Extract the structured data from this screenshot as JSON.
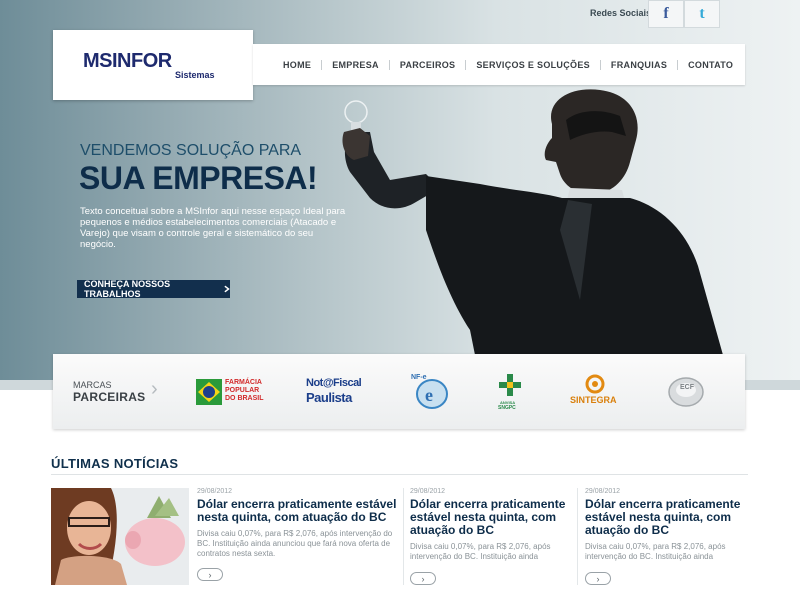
{
  "social": {
    "label": "Redes Sociais",
    "facebook": "f",
    "twitter": "t"
  },
  "logo": {
    "main": "MSINFOR",
    "sub": "Sistemas"
  },
  "nav": [
    "HOME",
    "EMPRESA",
    "PARCEIROS",
    "SERVIÇOS E SOLUÇÕES",
    "FRANQUIAS",
    "CONTATO"
  ],
  "hero": {
    "pre": "VENDEMOS SOLUÇÃO PARA",
    "title": "SUA EMPRESA!",
    "desc": "Texto conceitual sobre a MSInfor aqui nesse espaço Ideal para pequenos e médios estabelecimentos comerciais (Atacado e Varejo) que visam o controle geral e sistemático do seu negócio.",
    "cta": "CONHEÇA NOSSOS TRABALHOS"
  },
  "partners": {
    "label_small": "MARCAS",
    "label_big": "PARCEIRAS",
    "farmacia": [
      "FARMÁCIA",
      "POPULAR",
      "DO BRASIL"
    ],
    "nota_top": "Not@Fiscal",
    "nota_bottom": "Paulista",
    "nfe": "NF-e",
    "anvisa": [
      "ANVISA",
      "SNGPC"
    ],
    "sintegra": "SINTEGRA",
    "ecf": "ECF"
  },
  "news": {
    "title": "ÚLTIMAS NOTÍCIAS",
    "items": [
      {
        "date": "29/08/2012",
        "headline": "Dólar encerra praticamente estável nesta quinta, com atuação do BC",
        "body": "Divisa caiu 0,07%, para R$ 2,076, após intervenção do BC. Instituição ainda anunciou que fará nova oferta de contratos nesta sexta."
      },
      {
        "date": "29/08/2012",
        "headline": "Dólar encerra praticamente estável nesta quinta, com atuação do BC",
        "body": "Divisa caiu 0,07%, para R$ 2,076, após intervenção do BC. Instituição ainda"
      },
      {
        "date": "29/08/2012",
        "headline": "Dólar encerra praticamente estável nesta quinta, com atuação do BC",
        "body": "Divisa caiu 0,07%, para R$ 2,076, após intervenção do BC. Instituição ainda"
      }
    ],
    "more_icon": "›"
  },
  "colors": {
    "navy": "#0e2d4a",
    "logo_blue": "#1e2a6e",
    "facebook": "#3b5b9c",
    "twitter": "#33a9d8"
  }
}
